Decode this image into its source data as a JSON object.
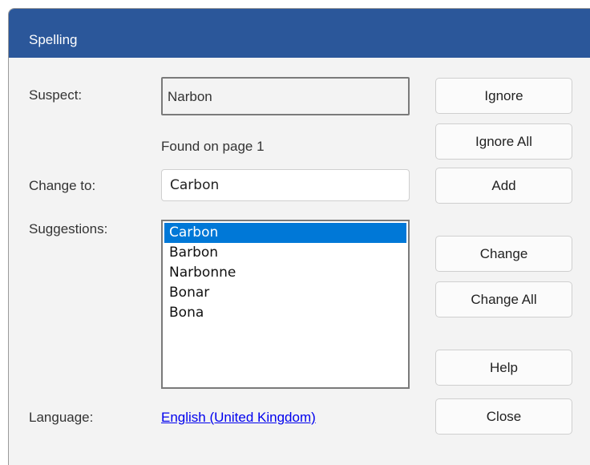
{
  "dialog": {
    "title": "Spelling"
  },
  "labels": {
    "suspect": "Suspect:",
    "change_to": "Change to:",
    "suggestions": "Suggestions:",
    "language": "Language:"
  },
  "suspect_word": "Narbon",
  "found_text": "Found on page 1",
  "change_to_value": "Carbon",
  "suggestions": [
    {
      "text": "Carbon",
      "selected": true
    },
    {
      "text": "Barbon",
      "selected": false
    },
    {
      "text": "Narbonne",
      "selected": false
    },
    {
      "text": "Bonar",
      "selected": false
    },
    {
      "text": "Bona",
      "selected": false
    }
  ],
  "language_link": "English (United Kingdom)",
  "buttons": {
    "ignore": "Ignore",
    "ignore_all": "Ignore All",
    "add": "Add",
    "change": "Change",
    "change_all": "Change All",
    "help": "Help",
    "close": "Close"
  },
  "colors": {
    "titlebar": "#2b579a",
    "selection": "#0078d7",
    "link": "#0000ee"
  }
}
